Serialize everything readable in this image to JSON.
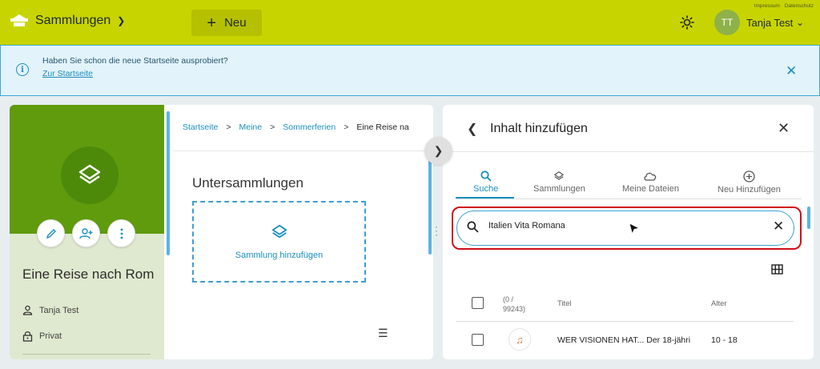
{
  "topbar": {
    "brand_label": "Sammlungen",
    "new_label": "Neu",
    "links": [
      "Impressum",
      "Datenschutz"
    ],
    "user_initials": "TT",
    "user_name": "Tanja Test",
    "accent_color": "#c8d400"
  },
  "banner": {
    "text": "Haben Sie schon die neue Startseite ausprobiert?",
    "link": "Zur Startseite"
  },
  "collection": {
    "title": "Eine Reise nach Rom",
    "owner": "Tanja Test",
    "visibility": "Privat",
    "actions": [
      "edit-icon",
      "share-user-icon",
      "more-vertical-icon"
    ]
  },
  "content": {
    "breadcrumbs": [
      "Startseite",
      "Meine",
      "Sommerferien",
      "Eine Reise na"
    ],
    "subcollections_heading": "Untersammlungen",
    "add_collection_label": "Sammlung hinzufügen"
  },
  "add_panel": {
    "title": "Inhalt hinzufügen",
    "tabs": [
      {
        "label": "Suche",
        "icon": "search-icon",
        "active": true
      },
      {
        "label": "Sammlungen",
        "icon": "layers-icon",
        "active": false
      },
      {
        "label": "Meine Dateien",
        "icon": "cloud-icon",
        "active": false
      },
      {
        "label": "Neu Hinzufügen",
        "icon": "add-circle-icon",
        "active": false
      }
    ],
    "search_value": "Italien Vita Romana",
    "table": {
      "count_label": "(0 / 99243)",
      "headers": {
        "title": "Titel",
        "age": "Alter"
      },
      "rows": [
        {
          "title": "WER VISIONEN HAT... Der 18-jähri",
          "age": "10 - 18",
          "icon": "audio-icon"
        }
      ]
    }
  }
}
